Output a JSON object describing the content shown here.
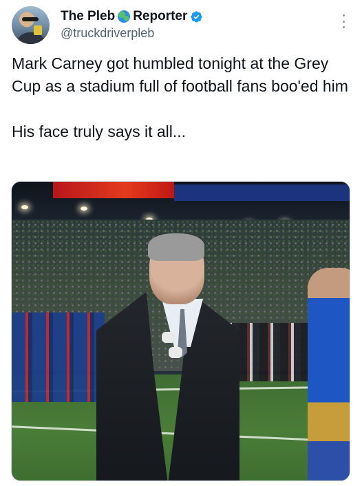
{
  "author": {
    "display_name": "The Pleb",
    "display_name_suffix": "Reporter",
    "handle": "@truckdriverpleb"
  },
  "tweet": {
    "paragraph_1": "Mark Carney got humbled tonight at the Grey Cup as a stadium full of football fans boo'ed him",
    "paragraph_2": "His face truly says it all..."
  },
  "icons": {
    "globe": "globe-icon",
    "verified": "verified-badge-icon",
    "more": "more-options-icon"
  },
  "colors": {
    "verified_blue": "#1d9bf0",
    "secondary_text": "#536471"
  }
}
